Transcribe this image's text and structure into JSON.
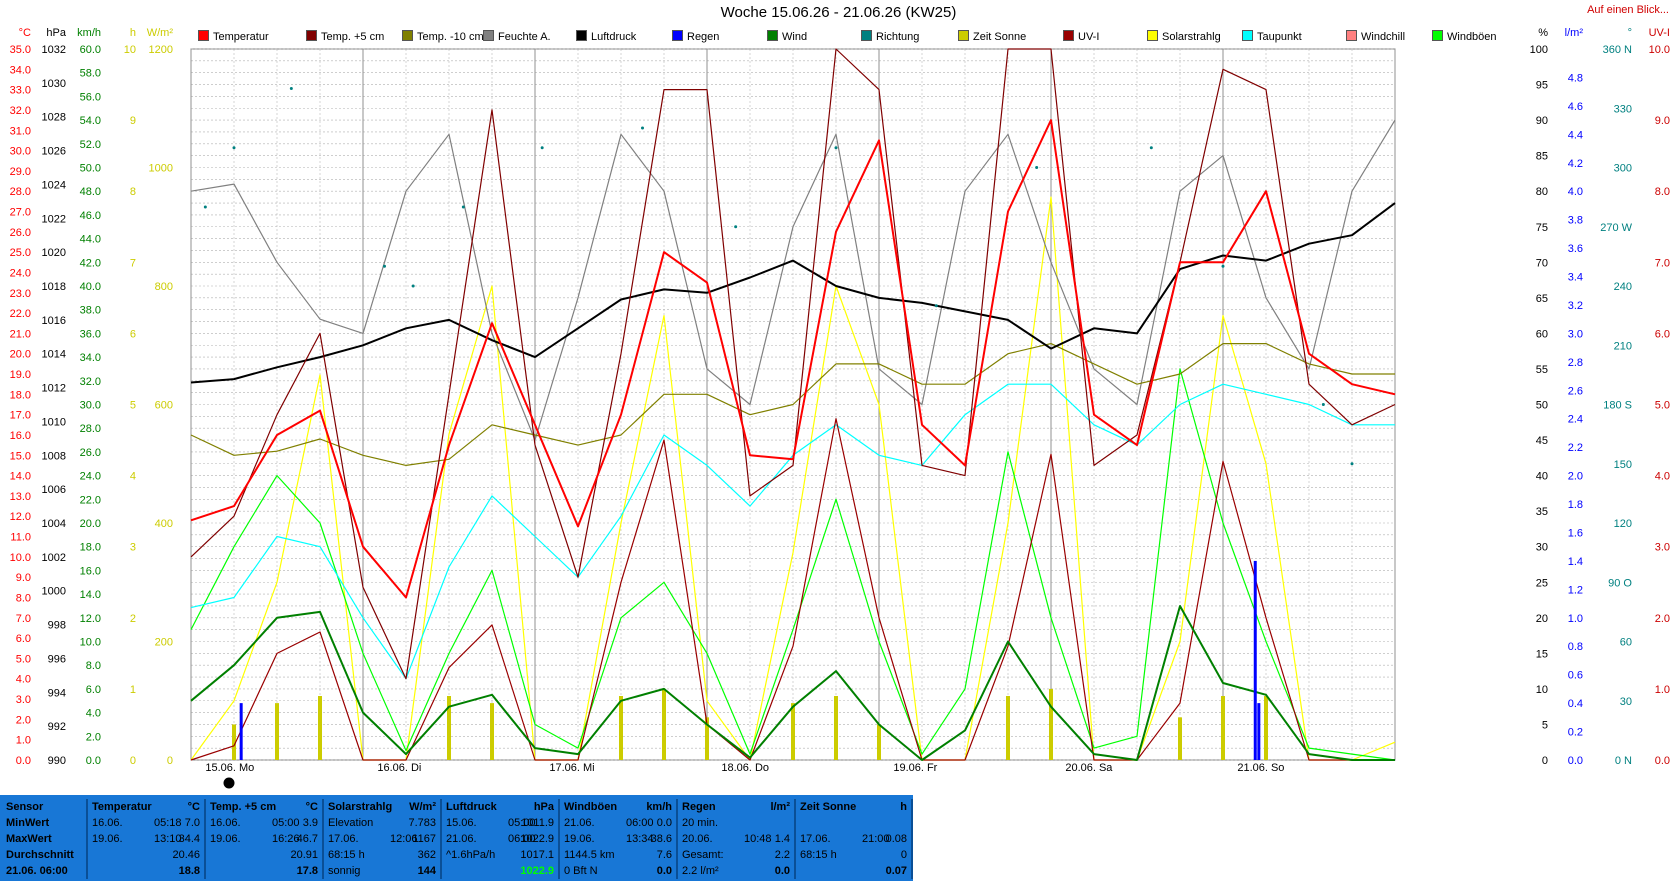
{
  "title": "Woche 15.06.26 - 21.06.26 (KW25)",
  "link_text": "Auf einen Blick...",
  "legend": [
    {
      "label": "Temperatur",
      "color": "#ff0000"
    },
    {
      "label": "Temp. +5 cm",
      "color": "#800000"
    },
    {
      "label": "Temp. -10 cm",
      "color": "#808000"
    },
    {
      "label": "Feuchte A.",
      "color": "#808080"
    },
    {
      "label": "Luftdruck",
      "color": "#000000"
    },
    {
      "label": "Regen",
      "color": "#0000ff"
    },
    {
      "label": "Wind",
      "color": "#008000"
    },
    {
      "label": "Richtung",
      "color": "#008080"
    },
    {
      "label": "Zeit Sonne",
      "color": "#cccc00"
    },
    {
      "label": "UV-I",
      "color": "#990000"
    },
    {
      "label": "Solarstrahlg",
      "color": "#ffff00"
    },
    {
      "label": "Taupunkt",
      "color": "#00ffff"
    },
    {
      "label": "Windchill",
      "color": "#ff8080"
    },
    {
      "label": "Windböen",
      "color": "#00ff00"
    }
  ],
  "axes": {
    "temp": {
      "unit": "°C",
      "color": "#ff0000",
      "ticks": [
        "35.0",
        "34.0",
        "33.0",
        "32.0",
        "31.0",
        "30.0",
        "29.0",
        "28.0",
        "27.0",
        "26.0",
        "25.0",
        "24.0",
        "23.0",
        "22.0",
        "21.0",
        "20.0",
        "19.0",
        "18.0",
        "17.0",
        "16.0",
        "15.0",
        "14.0",
        "13.0",
        "12.0",
        "11.0",
        "10.0",
        "9.0",
        "8.0",
        "7.0",
        "6.0",
        "5.0",
        "4.0",
        "3.0",
        "2.0",
        "1.0",
        "0.0"
      ]
    },
    "hpa": {
      "unit": "hPa",
      "ticks": [
        "1032",
        "1030",
        "1028",
        "1026",
        "1024",
        "1022",
        "1020",
        "1018",
        "1016",
        "1014",
        "1012",
        "1010",
        "1008",
        "1006",
        "1004",
        "1002",
        "1000",
        "998",
        "996",
        "994",
        "992",
        "990"
      ]
    },
    "kmh": {
      "unit": "km/h",
      "color": "#008000",
      "ticks": [
        "60.0",
        "58.0",
        "56.0",
        "54.0",
        "52.0",
        "50.0",
        "48.0",
        "46.0",
        "44.0",
        "42.0",
        "40.0",
        "38.0",
        "36.0",
        "34.0",
        "32.0",
        "30.0",
        "28.0",
        "26.0",
        "24.0",
        "22.0",
        "20.0",
        "18.0",
        "16.0",
        "14.0",
        "12.0",
        "10.0",
        "8.0",
        "6.0",
        "4.0",
        "2.0",
        "0.0"
      ]
    },
    "hours": {
      "unit": "h",
      "color": "#cccc00",
      "ticks": [
        "10",
        "9",
        "8",
        "7",
        "6",
        "5",
        "4",
        "3",
        "2",
        "1",
        "0"
      ]
    },
    "wm2": {
      "unit": "W/m²",
      "color": "#cccc00",
      "ticks": [
        "1200",
        "1000",
        "800",
        "600",
        "400",
        "200",
        "0"
      ]
    },
    "pct": {
      "unit": "%",
      "ticks": [
        "100",
        "95",
        "90",
        "85",
        "80",
        "75",
        "70",
        "65",
        "60",
        "55",
        "50",
        "45",
        "40",
        "35",
        "30",
        "25",
        "20",
        "15",
        "10",
        "5",
        "0"
      ]
    },
    "lm2": {
      "unit": "l/m²",
      "color": "#0000ff",
      "ticks": [
        "4.8",
        "4.6",
        "4.4",
        "4.2",
        "4.0",
        "3.8",
        "3.6",
        "3.4",
        "3.2",
        "3.0",
        "2.8",
        "2.6",
        "2.4",
        "2.2",
        "2.0",
        "1.8",
        "1.6",
        "1.4",
        "1.2",
        "1.0",
        "0.8",
        "0.6",
        "0.4",
        "0.2",
        "0.0"
      ]
    },
    "dir": {
      "unit": "°",
      "color": "#008080",
      "ticks": [
        "360 N",
        "330",
        "300",
        "270 W",
        "240",
        "210",
        "180 S",
        "150",
        "120",
        "90 O",
        "60",
        "30",
        "0 N"
      ]
    },
    "uv": {
      "unit": "UV-I",
      "color": "#cc0000",
      "ticks": [
        "10.0",
        "9.0",
        "8.0",
        "7.0",
        "6.0",
        "5.0",
        "4.0",
        "3.0",
        "2.0",
        "1.0",
        "0.0"
      ]
    }
  },
  "days": [
    "15.06. Mo",
    "16.06. Di",
    "17.06. Mi",
    "18.06. Do",
    "19.06. Fr",
    "20.06. Sa",
    "21.06. So"
  ],
  "chart_data": {
    "type": "line",
    "title": "Woche 15.06.26 - 21.06.26 (KW25)",
    "x_unit": "hours since 15.06. 00:00",
    "x": [
      0,
      6,
      12,
      18,
      24,
      30,
      36,
      42,
      48,
      54,
      60,
      66,
      72,
      78,
      84,
      90,
      96,
      102,
      108,
      114,
      120,
      126,
      132,
      138,
      144,
      150,
      156,
      162,
      168
    ],
    "series": [
      {
        "name": "Temperatur",
        "unit": "°C",
        "color": "#ff0000",
        "values": [
          11.8,
          12.5,
          16.0,
          17.2,
          10.5,
          8.0,
          15.5,
          21.5,
          16.5,
          11.5,
          17.0,
          25.0,
          23.5,
          15.0,
          14.8,
          26.0,
          30.5,
          16.5,
          14.5,
          27.0,
          31.5,
          17.0,
          15.5,
          24.5,
          24.5,
          28.0,
          20.0,
          18.5,
          18.0
        ]
      },
      {
        "name": "Temp. +5 cm",
        "unit": "°C",
        "color": "#800000",
        "values": [
          10.0,
          12.0,
          17.0,
          21.0,
          8.5,
          4.0,
          18.0,
          32.0,
          15.5,
          9.0,
          20.0,
          33.0,
          33.0,
          13.0,
          14.5,
          36.0,
          33.0,
          14.5,
          14.0,
          36.0,
          36.5,
          14.5,
          16.0,
          24.5,
          34.0,
          33.0,
          18.5,
          16.5,
          17.5
        ]
      },
      {
        "name": "Temp. -10 cm",
        "unit": "°C",
        "color": "#808000",
        "values": [
          16.0,
          15.0,
          15.2,
          15.8,
          15.0,
          14.5,
          14.8,
          16.5,
          16.0,
          15.5,
          16.0,
          18.0,
          18.0,
          17.0,
          17.5,
          19.5,
          19.5,
          18.5,
          18.5,
          20.0,
          20.5,
          19.5,
          18.5,
          19.0,
          20.5,
          20.5,
          19.5,
          19.0,
          19.0
        ]
      },
      {
        "name": "Feuchte A.",
        "unit": "%",
        "color": "#808080",
        "values": [
          80,
          81,
          70,
          62,
          60,
          80,
          88,
          60,
          45,
          65,
          88,
          80,
          55,
          50,
          75,
          88,
          55,
          50,
          80,
          88,
          70,
          55,
          50,
          80,
          85,
          65,
          55,
          80,
          90
        ]
      },
      {
        "name": "Luftdruck",
        "unit": "hPa",
        "color": "#000000",
        "values": [
          1012.3,
          1012.5,
          1013.2,
          1013.8,
          1014.5,
          1015.5,
          1016.0,
          1014.8,
          1013.8,
          1015.5,
          1017.2,
          1017.8,
          1017.6,
          1018.5,
          1019.5,
          1018.0,
          1017.3,
          1017.0,
          1016.5,
          1016.0,
          1014.3,
          1015.5,
          1015.2,
          1019.0,
          1019.8,
          1019.5,
          1020.5,
          1021.0,
          1022.9
        ]
      },
      {
        "name": "Wind",
        "unit": "km/h",
        "color": "#008000",
        "values": [
          5.0,
          8.0,
          12.0,
          12.5,
          4.0,
          0.5,
          4.5,
          5.5,
          1.0,
          0.5,
          5.0,
          6.0,
          3.0,
          0.2,
          4.5,
          7.5,
          3.0,
          0.0,
          2.5,
          10.0,
          4.5,
          0.5,
          0.0,
          13.0,
          6.5,
          5.5,
          0.5,
          0.0,
          0.0
        ]
      },
      {
        "name": "Windböen",
        "unit": "km/h",
        "color": "#00ff00",
        "values": [
          11.0,
          18.0,
          24.0,
          20.0,
          9.0,
          0.8,
          9.0,
          16.0,
          3.0,
          1.0,
          12.0,
          15.0,
          9.0,
          0.5,
          11.0,
          22.0,
          10.0,
          0.5,
          6.0,
          26.0,
          12.0,
          1.0,
          2.0,
          33.0,
          20.0,
          10.0,
          1.0,
          0.5,
          0.0
        ]
      },
      {
        "name": "Taupunkt",
        "unit": "°C",
        "color": "#00ffff",
        "values": [
          7.5,
          8.0,
          11.0,
          10.5,
          7.0,
          4.0,
          9.5,
          13.0,
          11.0,
          9.0,
          12.0,
          16.0,
          14.5,
          12.5,
          15.0,
          16.5,
          15.0,
          14.5,
          17.0,
          18.5,
          18.5,
          16.5,
          15.5,
          17.5,
          18.5,
          18.0,
          17.5,
          16.5,
          16.5
        ]
      },
      {
        "name": "Solarstrahlg",
        "unit": "W/m²",
        "color": "#ffff00",
        "values": [
          0,
          100,
          300,
          650,
          0,
          0,
          550,
          800,
          0,
          0,
          400,
          750,
          100,
          0,
          350,
          800,
          600,
          0,
          0,
          400,
          950,
          0,
          0,
          200,
          750,
          500,
          0,
          0,
          30
        ]
      },
      {
        "name": "UV-I",
        "unit": "UV-I",
        "color": "#990000",
        "values": [
          0,
          0.2,
          1.5,
          1.8,
          0,
          0,
          1.3,
          1.9,
          0,
          0,
          2.5,
          4.5,
          0.5,
          0,
          1.6,
          4.8,
          2.0,
          0,
          0,
          1.6,
          4.3,
          0,
          0,
          0.8,
          4.2,
          2.0,
          0,
          0,
          0
        ]
      },
      {
        "name": "Zeit Sonne",
        "unit": "h",
        "color": "#cccc00",
        "values": [
          0,
          0.5,
          0.8,
          0.9,
          0,
          0,
          0.9,
          0.8,
          0,
          0,
          0.9,
          1.0,
          0.6,
          0,
          0.8,
          0.9,
          0.5,
          0,
          0,
          0.9,
          1.0,
          0,
          0,
          0.6,
          0.9,
          0.9,
          0,
          0,
          0
        ]
      },
      {
        "name": "Regen",
        "unit": "l/m²",
        "color": "#0000ff",
        "bars": [
          {
            "x": 7,
            "value": 0.4
          },
          {
            "x": 148.5,
            "value": 1.4
          },
          {
            "x": 149,
            "value": 0.4
          }
        ]
      },
      {
        "name": "Richtung",
        "unit": "°",
        "color": "#008080",
        "dots": [
          {
            "x": 2,
            "value": 280
          },
          {
            "x": 6,
            "value": 310
          },
          {
            "x": 14,
            "value": 340
          },
          {
            "x": 27,
            "value": 250
          },
          {
            "x": 31,
            "value": 240
          },
          {
            "x": 38,
            "value": 280
          },
          {
            "x": 49,
            "value": 310
          },
          {
            "x": 63,
            "value": 320
          },
          {
            "x": 76,
            "value": 270
          },
          {
            "x": 90,
            "value": 310
          },
          {
            "x": 104,
            "value": 230
          },
          {
            "x": 118,
            "value": 300
          },
          {
            "x": 134,
            "value": 310
          },
          {
            "x": 144,
            "value": 250
          },
          {
            "x": 158,
            "value": 180
          },
          {
            "x": 162,
            "value": 150
          }
        ]
      }
    ]
  },
  "footer": {
    "sensor": {
      "title": "Sensor",
      "rows": [
        "MinWert",
        "MaxWert",
        "Durchschnitt",
        "21.06. 06:00"
      ]
    },
    "temp": {
      "title": "Temperatur",
      "unit": "°C",
      "rows": [
        [
          "16.06.",
          "05:18",
          "7.0"
        ],
        [
          "19.06.",
          "13:10",
          "34.4"
        ],
        [
          "",
          "",
          "20.46"
        ],
        [
          "",
          "",
          "18.8"
        ]
      ]
    },
    "temp5": {
      "title": "Temp. +5 cm",
      "unit": "°C",
      "rows": [
        [
          "16.06.",
          "05:00",
          "3.9"
        ],
        [
          "19.06.",
          "16:26",
          "46.7"
        ],
        [
          "",
          "",
          "20.91"
        ],
        [
          "",
          "",
          "17.8"
        ]
      ]
    },
    "solar": {
      "title": "Solarstrahlg",
      "unit": "W/m²",
      "rows": [
        [
          "Elevation",
          "",
          "7.783"
        ],
        [
          "17.06.",
          "12:06",
          "1167"
        ],
        [
          "68:15 h",
          "",
          "362"
        ],
        [
          "sonnig",
          "",
          "144"
        ]
      ]
    },
    "press": {
      "title": "Luftdruck",
      "unit": "hPa",
      "rows": [
        [
          "15.06.",
          "05:00",
          "1011.9"
        ],
        [
          "21.06.",
          "06:00",
          "1022.9"
        ],
        [
          "^1.6hPa/h",
          "",
          "1017.1"
        ],
        [
          "",
          "",
          "1022.9"
        ]
      ]
    },
    "gust": {
      "title": "Windböen",
      "unit": "km/h",
      "rows": [
        [
          "21.06.",
          "06:00",
          "0.0"
        ],
        [
          "19.06.",
          "13:34",
          "38.6"
        ],
        [
          "1144.5 km",
          "",
          "7.6"
        ],
        [
          "0 Bft N",
          "",
          "0.0"
        ]
      ]
    },
    "rain": {
      "title": "Regen",
      "unit": "l/m²",
      "rows": [
        [
          "20 min.",
          "",
          ""
        ],
        [
          "20.06.",
          "10:48",
          "1.4"
        ],
        [
          "Gesamt:",
          "",
          "2.2"
        ],
        [
          "2.2 l/m²",
          "",
          "0.0"
        ]
      ]
    },
    "sun": {
      "title": "Zeit Sonne",
      "unit": "h",
      "rows": [
        [
          "",
          "",
          ""
        ],
        [
          "17.06.",
          "21:00",
          "0.08"
        ],
        [
          "68:15 h",
          "",
          "0"
        ],
        [
          "",
          "",
          "0.07"
        ]
      ]
    }
  }
}
